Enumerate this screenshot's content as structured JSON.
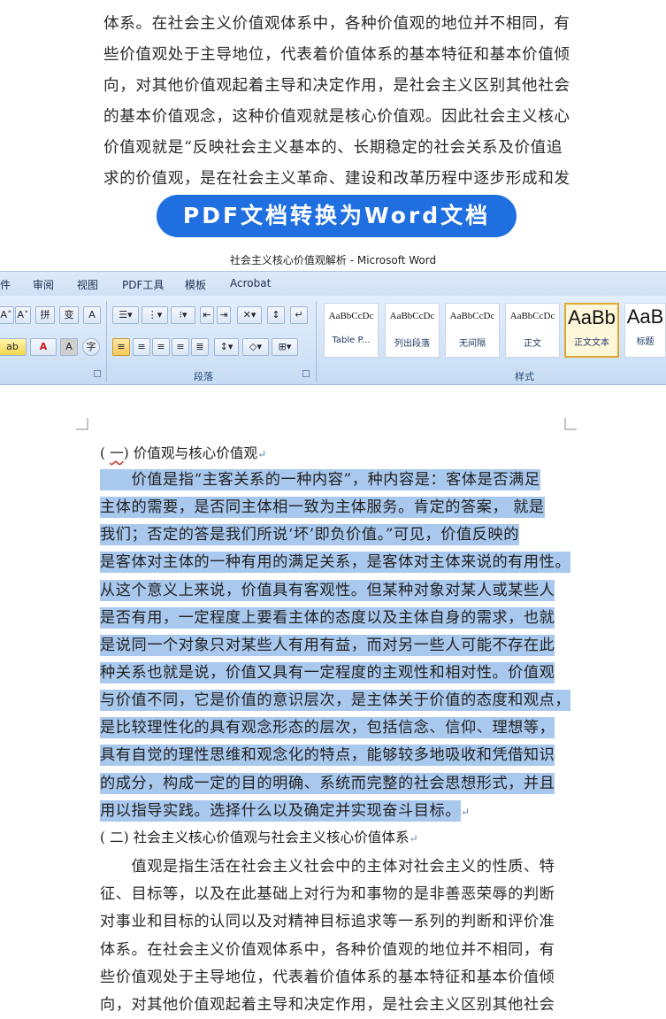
{
  "top_excerpt": [
    "体系。在社会主义价值观体系中，各种价值观的地位并不相同，有",
    "些价值观处于主导地位，代表着价值体系的基本特征和基本价值倾",
    "向，对其他价值观起着主导和决定作用，是社会主义区别其他社会",
    "的基本价值观念，这种价值观就是核心价值观。因此社会主义核心",
    "价值观就是“反映社会主义基本的、长期稳定的社会关系及价值追",
    "求的价值观，是在社会主义革命、建设和改革历程中逐步形成和发"
  ],
  "banner": {
    "text": "PDF文档转换为Word文档",
    "color": "#1f6fe0"
  },
  "window": {
    "title": "社会主义核心价值观解析 - Microsoft Word"
  },
  "menu": [
    "件",
    "审阅",
    "视图",
    "PDF工具",
    "模板",
    "Acrobat"
  ],
  "ribbon": {
    "font_buttons_row1": [
      "A˄",
      "A˅",
      "拼",
      "变",
      "A"
    ],
    "font_buttons_row2": [
      "ab",
      "A",
      "A",
      "字"
    ],
    "paragraph_label": "段落",
    "styles_label": "样式",
    "styles": [
      {
        "sample": "AaBbCcDc",
        "name": "Table P..."
      },
      {
        "sample": "AaBbCcDc",
        "name": "列出段落"
      },
      {
        "sample": "AaBbCcDc",
        "name": "无间隔"
      },
      {
        "sample": "AaBbCcDc",
        "name": "正文"
      },
      {
        "sample": "AaBb",
        "name": "正文文本"
      },
      {
        "sample": "AaB",
        "name": "标题"
      }
    ]
  },
  "document": {
    "heading1": {
      "open": "(",
      "num": "一",
      "close": ") 价值观与核心价值观"
    },
    "selected_lines": [
      "　　价值是指“主客关系的一种内容”，种内容是：客体是否满足",
      "主体的需要，是否同主体相一致为主体服务。肯定的答案，  就是",
      "我们；否定的答是我们所说‘坏’即负价值。”可见，价值反映的",
      "是客体对主体的一种有用的满足关系，是客体对主体来说的有用性。",
      "从这个意义上来说，价值具有客观性。但某种对象对某人或某些人",
      "是否有用，一定程度上要看主体的态度以及主体自身的需求，也就",
      "是说同一个对象只对某些人有用有益，而对另一些人可能不存在此",
      "种关系也就是说，价值又具有一定程度的主观性和相对性。价值观",
      "与价值不同，它是价值的意识层次，是主体关于价值的态度和观点，",
      "是比较理性化的具有观念形态的层次，包括信念、信仰、理想等，",
      "具有自觉的理性思维和观念化的特点，能够较多地吸收和凭借知识",
      "的成分，构成一定的目的明确、系统而完整的社会思想形式，并且",
      "用以指导实践。选择什么以及确定并实现奋斗目标。"
    ],
    "heading2": "( 二) 社会主义核心价值观与社会主义核心价值体系",
    "para2_lines": [
      "　　值观是指生活在社会主义社会中的主体对社会主义的性质、特",
      "征、目标等，以及在此基础上对行为和事物的是非善恶荣辱的判断",
      "对事业和目标的认同以及对精神目标追求等一系列的判断和评价准",
      "体系。在社会主义价值观体系中，各种价值观的地位并不相同，有",
      "些价值观处于主导地位，代表着价值体系的基本特征和基本价值倾",
      "向，对其他价值观起着主导和决定作用，是社会主义区别其他社会"
    ]
  }
}
